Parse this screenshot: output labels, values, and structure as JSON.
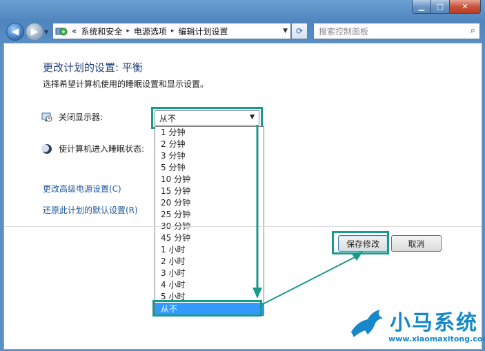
{
  "window": {
    "min_symbol": "▁",
    "max_symbol": "▢",
    "close_symbol": "✕"
  },
  "nav": {
    "back_symbol": "◀",
    "forward_symbol": "▶",
    "history_symbol": "▼",
    "breadcrumb_start": "«",
    "breadcrumbs": [
      "系统和安全",
      "电源选项",
      "编辑计划设置"
    ],
    "separator": "▸",
    "address_dropdown": "▼",
    "refresh_symbol": "⟳",
    "search_placeholder": "搜索控制面板",
    "search_symbol": "⌕"
  },
  "page": {
    "title": "更改计划的设置: 平衡",
    "subtitle": "选择希望计算机使用的睡眠设置和显示设置。"
  },
  "settings": {
    "display_label": "关闭显示器:",
    "display_value": "从不",
    "sleep_label": "使计算机进入睡眠状态:",
    "combo_arrow": "▼"
  },
  "dropdown_options": [
    "1 分钟",
    "2 分钟",
    "3 分钟",
    "5 分钟",
    "10 分钟",
    "15 分钟",
    "20 分钟",
    "25 分钟",
    "30 分钟",
    "45 分钟",
    "1 小时",
    "2 小时",
    "3 小时",
    "4 小时",
    "5 小时",
    "从不"
  ],
  "dropdown_selected_index": 15,
  "links": {
    "advanced": "更改高级电源设置(C)",
    "restore": "还原此计划的默认设置(R)"
  },
  "buttons": {
    "save": "保存修改",
    "cancel": "取消"
  },
  "watermark": {
    "brand": "小马系统",
    "url": "www.xiaomaxitong.com"
  },
  "colors": {
    "highlight": "#1a9a8a",
    "link": "#1e5aa0",
    "selection": "#3399ff",
    "title": "#1f3f7a"
  }
}
